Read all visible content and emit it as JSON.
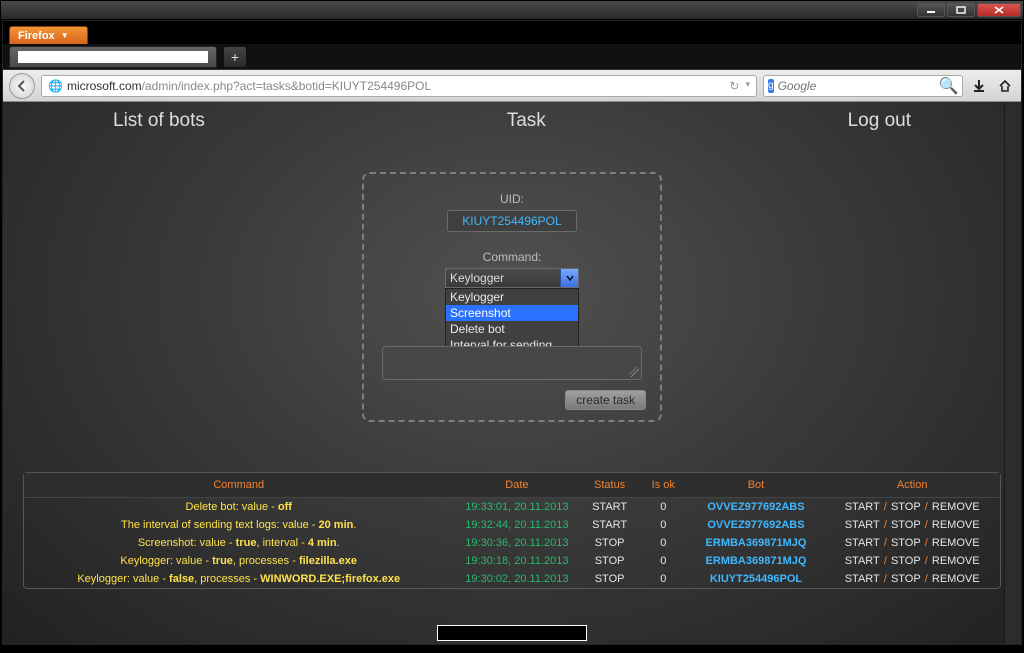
{
  "browser": {
    "app_button": "Firefox",
    "url_host": "microsoft.com",
    "url_path": "/admin/index.php?act=tasks&botid=KIUYT254496POL",
    "search_placeholder": "Google"
  },
  "nav": {
    "list_of_bots": "List of bots",
    "task": "Task",
    "log_out": "Log out"
  },
  "task_panel": {
    "uid_label": "UID:",
    "uid_value": "KIUYT254496POL",
    "command_label": "Command:",
    "selected": "Keylogger",
    "options": [
      "Keylogger",
      "Screenshot",
      "Delete bot",
      "Interval for sending logs"
    ],
    "create_btn": "create task"
  },
  "history": {
    "headers": {
      "command": "Command",
      "date": "Date",
      "status": "Status",
      "is_ok": "Is ok",
      "bot": "Bot",
      "action": "Action"
    },
    "actions": {
      "start": "START",
      "stop": "STOP",
      "remove": "REMOVE"
    },
    "rows": [
      {
        "cmd_html": "Delete bot: value - <b>off</b>",
        "date": "19:33:01, 20.11.2013",
        "status": "START",
        "is_ok": "0",
        "bot": "OVVEZ977692ABS"
      },
      {
        "cmd_html": "The interval of sending text logs: value - <b>20 min</b>.",
        "date": "19:32:44, 20.11.2013",
        "status": "START",
        "is_ok": "0",
        "bot": "OVVEZ977692ABS"
      },
      {
        "cmd_html": "Screenshot: value - <b>true</b>, interval - <b>4 min</b>.",
        "date": "19:30:36, 20.11.2013",
        "status": "STOP",
        "is_ok": "0",
        "bot": "ERMBA369871MJQ"
      },
      {
        "cmd_html": "Keylogger: value - <b>true</b>, processes - <b>filezilla.exe</b>",
        "date": "19:30:18, 20.11.2013",
        "status": "STOP",
        "is_ok": "0",
        "bot": "ERMBA369871MJQ"
      },
      {
        "cmd_html": "Keylogger: value - <b>false</b>, processes - <b>WINWORD.EXE;firefox.exe</b>",
        "date": "19:30:02, 20.11.2013",
        "status": "STOP",
        "is_ok": "0",
        "bot": "KIUYT254496POL"
      }
    ]
  }
}
